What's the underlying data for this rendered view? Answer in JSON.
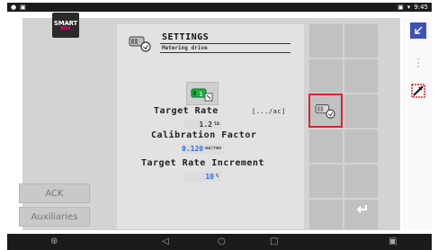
{
  "status_bar": {
    "left_icons": [
      "notification-dot-icon",
      "notification-square-icon"
    ],
    "right_text": "9:45"
  },
  "left_panel": {
    "logo_line1": "SMART",
    "logo_line2": "BOX",
    "ack_label": "ACK",
    "auxiliaries_label": "Auxiliaries"
  },
  "settings": {
    "title": "SETTINGS",
    "subtitle": "Metering drive",
    "target_rate_label": "Target Rate",
    "target_rate_unit_hint": "[.../ac]",
    "target_rate_value": "1.2",
    "target_rate_unit": "lb",
    "calibration_label": "Calibration Factor",
    "calibration_value": "0.120",
    "calibration_unit": "oz/rev",
    "increment_label": "Target Rate Increment",
    "increment_value": "10",
    "increment_unit": "%"
  },
  "colors": {
    "accent_blue": "#3f51b5",
    "highlight_red": "#e0202a",
    "panel_bg": "#e2e2e2",
    "value_blue": "#2a6df0"
  },
  "nav": {
    "icons": [
      "android-icon",
      "back-triangle-icon",
      "home-circle-icon",
      "recents-square-icon",
      "screenshot-icon"
    ]
  }
}
